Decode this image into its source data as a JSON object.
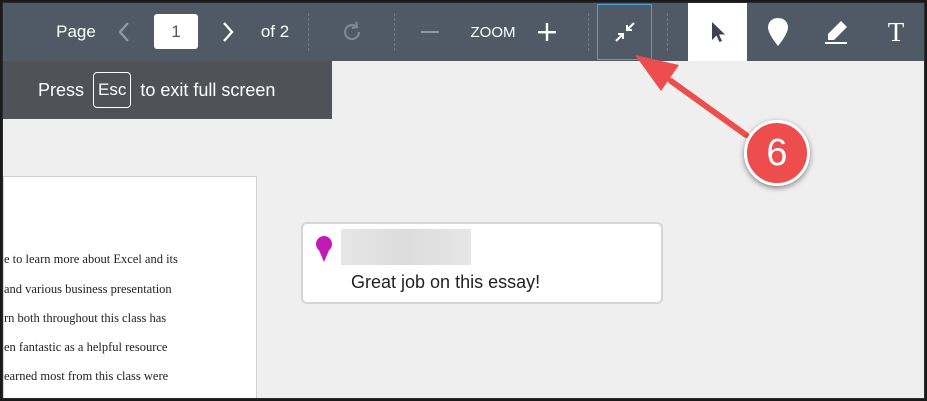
{
  "toolbar": {
    "page_label": "Page",
    "page_value": "1",
    "of_label": "of 2",
    "zoom_label": "ZOOM",
    "zoom_out_glyph": "—",
    "zoom_in_glyph": "+",
    "prev_glyph": "<",
    "next_glyph": ">",
    "text_tool_glyph": "T",
    "bar_color": "#4f5a66",
    "active_tool": "select"
  },
  "banner": {
    "press": "Press",
    "key": "Esc",
    "rest": "to exit full screen"
  },
  "document": {
    "lines": [
      "e to learn more about Excel and its",
      "and various business presentation",
      "rn both throughout this class has",
      "en fantastic as a helpful resource",
      "earned most from this class were"
    ]
  },
  "comment": {
    "text": "Great job on this essay!",
    "pin_color": "#c21bb5"
  },
  "callout": {
    "number": "6",
    "color": "#ee4d4d"
  }
}
